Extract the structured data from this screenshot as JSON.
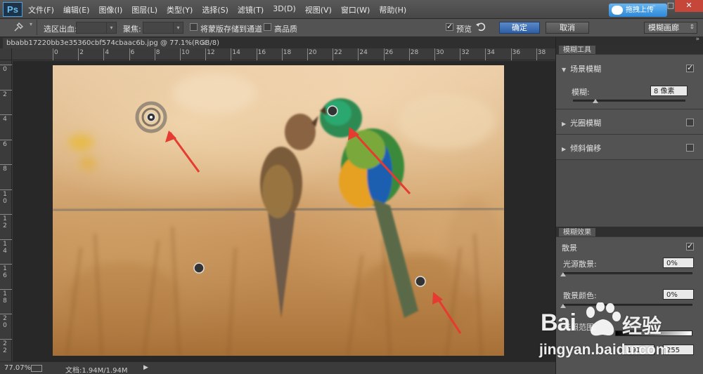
{
  "app": {
    "logo": "Ps"
  },
  "menu": [
    "文件(F)",
    "编辑(E)",
    "图像(I)",
    "图层(L)",
    "类型(Y)",
    "选择(S)",
    "滤镜(T)",
    "3D(D)",
    "视图(V)",
    "窗口(W)",
    "帮助(H)"
  ],
  "upload": {
    "label": "拖拽上传",
    "icon": "cloud-icon"
  },
  "window_controls": {
    "minimize": "–",
    "maximize": "□",
    "close": "✕"
  },
  "options": {
    "tool_icon": "pin-icon",
    "selection_bleed_label": "选区出血:",
    "focus_label": "聚焦:",
    "save_mask_label": "将蒙版存储到通道",
    "high_quality_label": "高品质",
    "preview_label": "预览",
    "ok_label": "确定",
    "cancel_label": "取消",
    "mode_value": "模糊画廊"
  },
  "document": {
    "tab_title": "bbabb17220bb3e35360cbf574cbaac6b.jpg @ 77.1%(RGB/8)",
    "close": "×"
  },
  "rulers": {
    "top": [
      "0",
      "2",
      "4",
      "6",
      "8",
      "10",
      "12",
      "14",
      "16",
      "18",
      "20",
      "22",
      "24",
      "26",
      "28",
      "30",
      "32",
      "34",
      "36",
      "38"
    ],
    "left": [
      "0",
      "2",
      "4",
      "6",
      "8",
      "10",
      "12",
      "14",
      "16",
      "18",
      "20",
      "22"
    ]
  },
  "status": {
    "zoom": "77.07%",
    "doc_info": "文档:1.94M/1.94M",
    "arrow": "▶"
  },
  "blur_tools": {
    "tab": "模糊工具",
    "field_blur": {
      "title": "场景模糊",
      "checked": true,
      "blur_label": "模糊:",
      "blur_value": "8 像素",
      "blur_level": 0.2
    },
    "iris_blur": {
      "title": "光圈模糊",
      "checked": false
    },
    "tilt_shift": {
      "title": "倾斜偏移",
      "checked": false
    }
  },
  "blur_effects": {
    "tab": "模糊效果",
    "bokeh": {
      "title": "散景",
      "checked": true
    },
    "light_bokeh": {
      "label": "光源散景:",
      "value": "0%",
      "level": 0
    },
    "bokeh_color": {
      "label": "散景颜色:",
      "value": "0%",
      "level": 0
    },
    "light_range": {
      "label": "光照范围:",
      "low": "191",
      "high": "255"
    }
  },
  "watermark": {
    "brand": "Bai",
    "brand_cn": "经验",
    "url": "jingyan.baidu.com"
  }
}
